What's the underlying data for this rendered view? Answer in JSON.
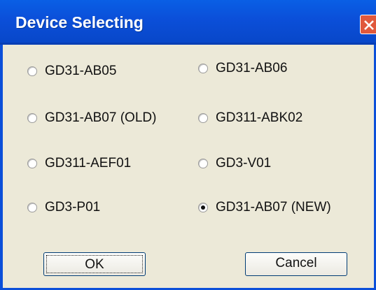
{
  "window": {
    "title": "Device Selecting"
  },
  "devices": [
    {
      "label": "GD31-AB05",
      "checked": false
    },
    {
      "label": "GD31-AB06",
      "checked": false
    },
    {
      "label": "GD31-AB07 (OLD)",
      "checked": false
    },
    {
      "label": "GD311-ABK02",
      "checked": false
    },
    {
      "label": "GD311-AEF01",
      "checked": false
    },
    {
      "label": "GD3-V01",
      "checked": false
    },
    {
      "label": "GD3-P01",
      "checked": false
    },
    {
      "label": "GD31-AB07 (NEW)",
      "checked": true
    }
  ],
  "buttons": {
    "ok": "OK",
    "cancel": "Cancel"
  }
}
